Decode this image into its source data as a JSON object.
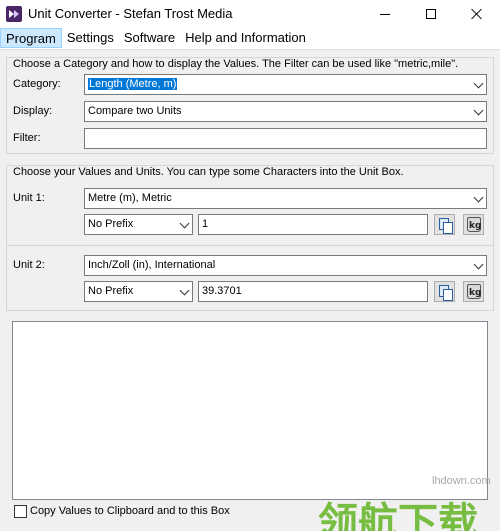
{
  "window": {
    "title": "Unit Converter - Stefan Trost Media"
  },
  "menu": [
    {
      "label": "Program"
    },
    {
      "label": "Settings"
    },
    {
      "label": "Software"
    },
    {
      "label": "Help and Information"
    }
  ],
  "category_section": {
    "description": "Choose a Category and how to display the Values. The Filter can be used like \"metric,mile\".",
    "category_label": "Category:",
    "category_value": "Length (Metre, m)",
    "display_label": "Display:",
    "display_value": "Compare two Units",
    "filter_label": "Filter:",
    "filter_value": ""
  },
  "units_section": {
    "description": "Choose your Values and Units. You can type some Characters into the Unit Box.",
    "unit1": {
      "label": "Unit 1:",
      "unit_value": "Metre (m), Metric",
      "prefix_value": "No Prefix",
      "amount_value": "1"
    },
    "unit2": {
      "label": "Unit 2:",
      "unit_value": "Inch/Zoll (in), International",
      "prefix_value": "No Prefix",
      "amount_value": "39.3701"
    }
  },
  "result": {
    "content": ""
  },
  "clipboard_option": {
    "label": "Copy Values to Clipboard and to this Box",
    "checked": false
  },
  "watermark": {
    "url": "lhdown.com",
    "text": "领航下载"
  },
  "icons": {
    "copy": "copy-icon",
    "kg": "kg-weight-icon",
    "kg_text": "kg"
  },
  "colors": {
    "selection": "#0078d7",
    "menu_highlight": "#cce8ff",
    "watermark_green": "#6ab82f",
    "app_icon": "#4b2666"
  }
}
